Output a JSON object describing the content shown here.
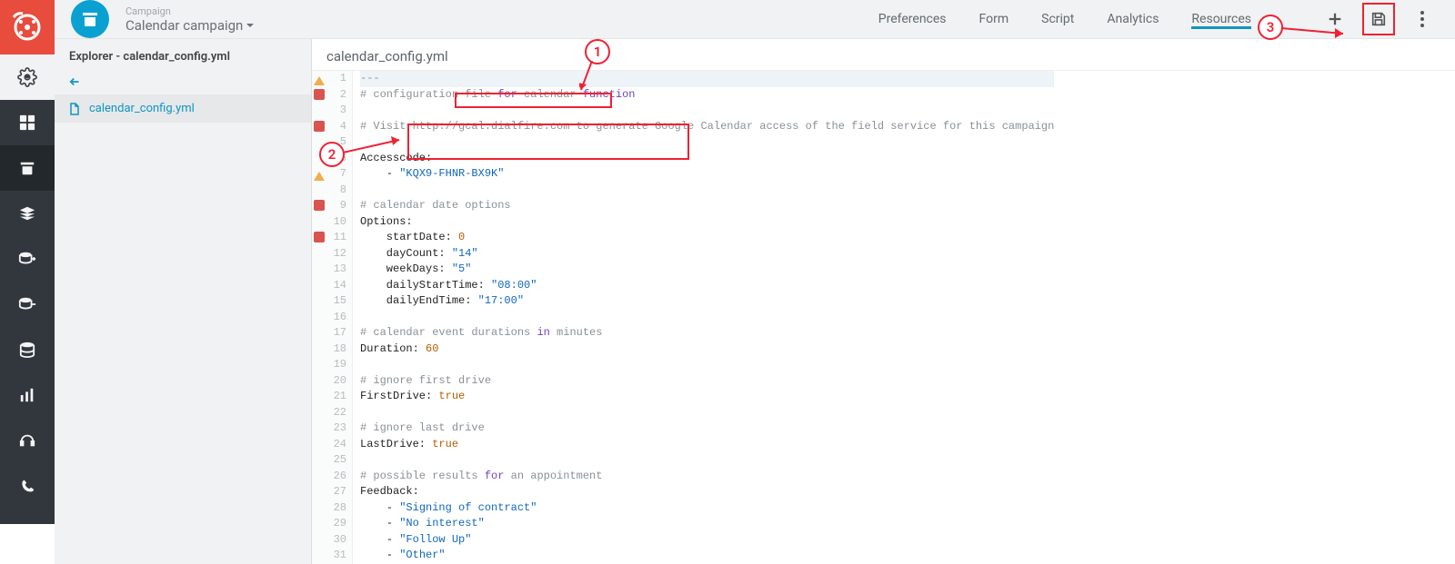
{
  "campaign": {
    "label": "Campaign",
    "name": "Calendar campaign"
  },
  "tabs": [
    "Preferences",
    "Form",
    "Script",
    "Analytics",
    "Resources"
  ],
  "active_tab": 4,
  "explorer": {
    "title_prefix": "Explorer - ",
    "title_file": "calendar_config.yml",
    "file": "calendar_config.yml"
  },
  "editor": {
    "title": "calendar_config.yml",
    "lines": [
      {
        "n": 1,
        "ic": "warn",
        "tokens": [
          [
            "com",
            "---"
          ]
        ]
      },
      {
        "n": 2,
        "ic": "err",
        "tokens": [
          [
            "com",
            "# configuration file "
          ],
          [
            "kw",
            "for"
          ],
          [
            "com",
            " calendar "
          ],
          [
            "kw",
            "function"
          ]
        ]
      },
      {
        "n": 3,
        "ic": null,
        "tokens": []
      },
      {
        "n": 4,
        "ic": "err",
        "tokens": [
          [
            "com",
            "# Visit "
          ],
          [
            "url",
            "http://gcal.dialfire.com"
          ],
          [
            "com",
            " to generate Google Calendar access of the field service for this campaign"
          ]
        ]
      },
      {
        "n": 5,
        "ic": null,
        "tokens": []
      },
      {
        "n": 6,
        "ic": null,
        "tokens": [
          [
            "key",
            "Accesscode:"
          ]
        ]
      },
      {
        "n": 7,
        "ic": "warn",
        "tokens": [
          [
            "key",
            "    - "
          ],
          [
            "str",
            "\"KQX9-FHNR-BX9K\""
          ]
        ]
      },
      {
        "n": 8,
        "ic": null,
        "tokens": []
      },
      {
        "n": 9,
        "ic": "err",
        "tokens": [
          [
            "com",
            "# calendar date options"
          ]
        ]
      },
      {
        "n": 10,
        "ic": null,
        "tokens": [
          [
            "key",
            "Options:"
          ]
        ]
      },
      {
        "n": 11,
        "ic": "err",
        "tokens": [
          [
            "key",
            "    startDate: "
          ],
          [
            "num",
            "0"
          ]
        ]
      },
      {
        "n": 12,
        "ic": null,
        "tokens": [
          [
            "key",
            "    dayCount: "
          ],
          [
            "str",
            "\"14\""
          ]
        ]
      },
      {
        "n": 13,
        "ic": null,
        "tokens": [
          [
            "key",
            "    weekDays: "
          ],
          [
            "str",
            "\"5\""
          ]
        ]
      },
      {
        "n": 14,
        "ic": null,
        "tokens": [
          [
            "key",
            "    dailyStartTime: "
          ],
          [
            "str",
            "\"08:00\""
          ]
        ]
      },
      {
        "n": 15,
        "ic": null,
        "tokens": [
          [
            "key",
            "    dailyEndTime: "
          ],
          [
            "str",
            "\"17:00\""
          ]
        ]
      },
      {
        "n": 16,
        "ic": null,
        "tokens": []
      },
      {
        "n": 17,
        "ic": null,
        "tokens": [
          [
            "com",
            "# calendar event durations "
          ],
          [
            "kw",
            "in"
          ],
          [
            "com",
            " minutes"
          ]
        ]
      },
      {
        "n": 18,
        "ic": null,
        "tokens": [
          [
            "key",
            "Duration: "
          ],
          [
            "num",
            "60"
          ]
        ]
      },
      {
        "n": 19,
        "ic": null,
        "tokens": []
      },
      {
        "n": 20,
        "ic": null,
        "tokens": [
          [
            "com",
            "# ignore first drive"
          ]
        ]
      },
      {
        "n": 21,
        "ic": null,
        "tokens": [
          [
            "key",
            "FirstDrive: "
          ],
          [
            "bool",
            "true"
          ]
        ]
      },
      {
        "n": 22,
        "ic": null,
        "tokens": []
      },
      {
        "n": 23,
        "ic": null,
        "tokens": [
          [
            "com",
            "# ignore last drive"
          ]
        ]
      },
      {
        "n": 24,
        "ic": null,
        "tokens": [
          [
            "key",
            "LastDrive: "
          ],
          [
            "bool",
            "true"
          ]
        ]
      },
      {
        "n": 25,
        "ic": null,
        "tokens": []
      },
      {
        "n": 26,
        "ic": null,
        "tokens": [
          [
            "com",
            "# possible results "
          ],
          [
            "kw",
            "for"
          ],
          [
            "com",
            " an appointment"
          ]
        ]
      },
      {
        "n": 27,
        "ic": null,
        "tokens": [
          [
            "key",
            "Feedback:"
          ]
        ]
      },
      {
        "n": 28,
        "ic": null,
        "tokens": [
          [
            "key",
            "    - "
          ],
          [
            "str",
            "\"Signing of contract\""
          ]
        ]
      },
      {
        "n": 29,
        "ic": null,
        "tokens": [
          [
            "key",
            "    - "
          ],
          [
            "str",
            "\"No interest\""
          ]
        ]
      },
      {
        "n": 30,
        "ic": null,
        "tokens": [
          [
            "key",
            "    - "
          ],
          [
            "str",
            "\"Follow Up\""
          ]
        ]
      },
      {
        "n": 31,
        "ic": null,
        "tokens": [
          [
            "key",
            "    - "
          ],
          [
            "str",
            "\"Other\""
          ]
        ]
      }
    ]
  },
  "annotations": {
    "a1": "1",
    "a2": "2",
    "a3": "3"
  }
}
